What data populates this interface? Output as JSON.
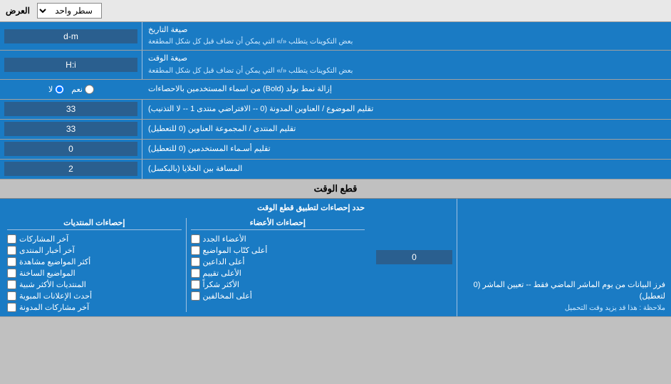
{
  "topSelect": {
    "label": "العرض",
    "options": [
      "سطر واحد"
    ],
    "selected": "سطر واحد"
  },
  "dateFormat": {
    "label": "صيغة التاريخ",
    "subLabel": "بعض التكوينات يتطلب «/» التي يمكن أن تضاف قبل كل شكل المطقعة",
    "value": "d-m"
  },
  "timeFormat": {
    "label": "صيغة الوقت",
    "subLabel": "بعض التكوينات يتطلب «/» التي يمكن أن تضاف قبل كل شكل المطقعة",
    "value": "H:i"
  },
  "boldOption": {
    "label": "إزالة نمط بولد (Bold) من اسماء المستخدمين بالاحصاءات",
    "yes": "نعم",
    "no": "لا",
    "selected": "no"
  },
  "titlesCount": {
    "label": "تقليم الموضوع / العناوين المدونة (0 -- الافتراضي منتدى 1 -- لا التذنيب)",
    "value": "33"
  },
  "forumTitles": {
    "label": "تقليم المنتدى / المجموعة العناوين (0 للتعطيل)",
    "value": "33"
  },
  "usernames": {
    "label": "تقليم أسـماء المستخدمين (0 للتعطيل)",
    "value": "0"
  },
  "columnSpacing": {
    "label": "المسافة بين الخلايا (بالبكسل)",
    "value": "2"
  },
  "sectionHeader": "قطع الوقت",
  "cutTime": {
    "label": "فرز البيانات من يوم الماشر الماضي فقط -- تعيين الماشر (0 لتعطيل)",
    "note": "ملاحظة : هذا قد يزيد وقت التحميل",
    "value": "0"
  },
  "limitLabel": "حدد إحصاءات لتطبيق قطع الوقت",
  "columns": {
    "col1Header": "إحصاءات الأعضاء",
    "col1Items": [
      "الأعضاء الجدد",
      "أعلى كتّاب المواضيع",
      "أعلى الداعين",
      "الأعلى تقييم",
      "الأكثر شكراً",
      "أعلى المخالفين"
    ],
    "col2Header": "إحصاءات المنتديات",
    "col2Items": [
      "آخر المشاركات",
      "آخر أخبار المنتدى",
      "أكثر المواضيع مشاهدة",
      "المواضيع الساخنة",
      "المنتديات الأكثر شبية",
      "أحدث الإعلانات المبوية",
      "آخر مشاركات المدونة"
    ]
  }
}
